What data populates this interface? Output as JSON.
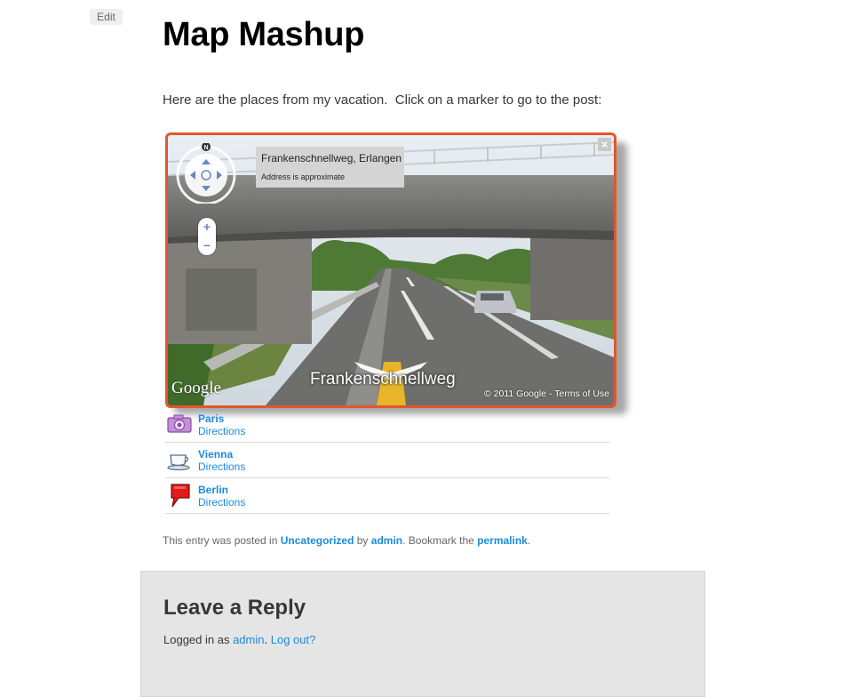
{
  "edit_label": "Edit",
  "page_title": "Map Mashup",
  "intro_text": "Here are the places from my vacation.  Click on a marker to go to the post:",
  "street_view": {
    "address_title": "Frankenschnellweg, Erlangen",
    "address_note": "Address is approximate",
    "street_name": "Frankenschnellweg",
    "compass_label": "N",
    "zoom_in": "+",
    "zoom_out": "−",
    "close": "×",
    "google_logo": "Google",
    "copyright": "© 2011 Google - Terms of Use",
    "accent_color": "#e2572b"
  },
  "locations": [
    {
      "name": "Paris",
      "directions": "Directions",
      "icon": "camera-icon"
    },
    {
      "name": "Vienna",
      "directions": "Directions",
      "icon": "coffee-cup-icon"
    },
    {
      "name": "Berlin",
      "directions": "Directions",
      "icon": "speech-bubble-icon"
    }
  ],
  "entry_meta": {
    "prefix": "This entry was posted in ",
    "category": "Uncategorized",
    "by": " by ",
    "author": "admin",
    "bookmark": ". Bookmark the ",
    "permalink": "permalink",
    "end": "."
  },
  "reply": {
    "title": "Leave a Reply",
    "logged_prefix": "Logged in as ",
    "user": "admin",
    "separator": ". ",
    "logout": "Log out?"
  },
  "link_color": "#1b8be0"
}
